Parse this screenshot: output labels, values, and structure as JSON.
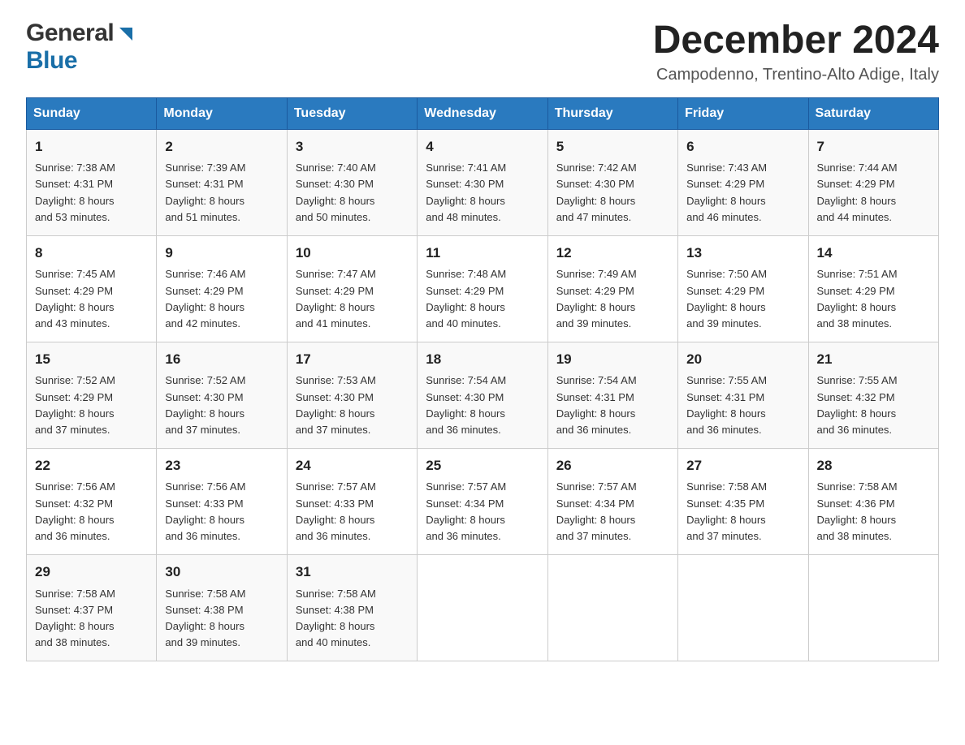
{
  "logo": {
    "general": "General",
    "blue": "Blue"
  },
  "header": {
    "month_year": "December 2024",
    "location": "Campodenno, Trentino-Alto Adige, Italy"
  },
  "weekdays": [
    "Sunday",
    "Monday",
    "Tuesday",
    "Wednesday",
    "Thursday",
    "Friday",
    "Saturday"
  ],
  "weeks": [
    [
      {
        "day": "1",
        "sunrise": "7:38 AM",
        "sunset": "4:31 PM",
        "daylight": "8 hours and 53 minutes."
      },
      {
        "day": "2",
        "sunrise": "7:39 AM",
        "sunset": "4:31 PM",
        "daylight": "8 hours and 51 minutes."
      },
      {
        "day": "3",
        "sunrise": "7:40 AM",
        "sunset": "4:30 PM",
        "daylight": "8 hours and 50 minutes."
      },
      {
        "day": "4",
        "sunrise": "7:41 AM",
        "sunset": "4:30 PM",
        "daylight": "8 hours and 48 minutes."
      },
      {
        "day": "5",
        "sunrise": "7:42 AM",
        "sunset": "4:30 PM",
        "daylight": "8 hours and 47 minutes."
      },
      {
        "day": "6",
        "sunrise": "7:43 AM",
        "sunset": "4:29 PM",
        "daylight": "8 hours and 46 minutes."
      },
      {
        "day": "7",
        "sunrise": "7:44 AM",
        "sunset": "4:29 PM",
        "daylight": "8 hours and 44 minutes."
      }
    ],
    [
      {
        "day": "8",
        "sunrise": "7:45 AM",
        "sunset": "4:29 PM",
        "daylight": "8 hours and 43 minutes."
      },
      {
        "day": "9",
        "sunrise": "7:46 AM",
        "sunset": "4:29 PM",
        "daylight": "8 hours and 42 minutes."
      },
      {
        "day": "10",
        "sunrise": "7:47 AM",
        "sunset": "4:29 PM",
        "daylight": "8 hours and 41 minutes."
      },
      {
        "day": "11",
        "sunrise": "7:48 AM",
        "sunset": "4:29 PM",
        "daylight": "8 hours and 40 minutes."
      },
      {
        "day": "12",
        "sunrise": "7:49 AM",
        "sunset": "4:29 PM",
        "daylight": "8 hours and 39 minutes."
      },
      {
        "day": "13",
        "sunrise": "7:50 AM",
        "sunset": "4:29 PM",
        "daylight": "8 hours and 39 minutes."
      },
      {
        "day": "14",
        "sunrise": "7:51 AM",
        "sunset": "4:29 PM",
        "daylight": "8 hours and 38 minutes."
      }
    ],
    [
      {
        "day": "15",
        "sunrise": "7:52 AM",
        "sunset": "4:29 PM",
        "daylight": "8 hours and 37 minutes."
      },
      {
        "day": "16",
        "sunrise": "7:52 AM",
        "sunset": "4:30 PM",
        "daylight": "8 hours and 37 minutes."
      },
      {
        "day": "17",
        "sunrise": "7:53 AM",
        "sunset": "4:30 PM",
        "daylight": "8 hours and 37 minutes."
      },
      {
        "day": "18",
        "sunrise": "7:54 AM",
        "sunset": "4:30 PM",
        "daylight": "8 hours and 36 minutes."
      },
      {
        "day": "19",
        "sunrise": "7:54 AM",
        "sunset": "4:31 PM",
        "daylight": "8 hours and 36 minutes."
      },
      {
        "day": "20",
        "sunrise": "7:55 AM",
        "sunset": "4:31 PM",
        "daylight": "8 hours and 36 minutes."
      },
      {
        "day": "21",
        "sunrise": "7:55 AM",
        "sunset": "4:32 PM",
        "daylight": "8 hours and 36 minutes."
      }
    ],
    [
      {
        "day": "22",
        "sunrise": "7:56 AM",
        "sunset": "4:32 PM",
        "daylight": "8 hours and 36 minutes."
      },
      {
        "day": "23",
        "sunrise": "7:56 AM",
        "sunset": "4:33 PM",
        "daylight": "8 hours and 36 minutes."
      },
      {
        "day": "24",
        "sunrise": "7:57 AM",
        "sunset": "4:33 PM",
        "daylight": "8 hours and 36 minutes."
      },
      {
        "day": "25",
        "sunrise": "7:57 AM",
        "sunset": "4:34 PM",
        "daylight": "8 hours and 36 minutes."
      },
      {
        "day": "26",
        "sunrise": "7:57 AM",
        "sunset": "4:34 PM",
        "daylight": "8 hours and 37 minutes."
      },
      {
        "day": "27",
        "sunrise": "7:58 AM",
        "sunset": "4:35 PM",
        "daylight": "8 hours and 37 minutes."
      },
      {
        "day": "28",
        "sunrise": "7:58 AM",
        "sunset": "4:36 PM",
        "daylight": "8 hours and 38 minutes."
      }
    ],
    [
      {
        "day": "29",
        "sunrise": "7:58 AM",
        "sunset": "4:37 PM",
        "daylight": "8 hours and 38 minutes."
      },
      {
        "day": "30",
        "sunrise": "7:58 AM",
        "sunset": "4:38 PM",
        "daylight": "8 hours and 39 minutes."
      },
      {
        "day": "31",
        "sunrise": "7:58 AM",
        "sunset": "4:38 PM",
        "daylight": "8 hours and 40 minutes."
      },
      null,
      null,
      null,
      null
    ]
  ],
  "labels": {
    "sunrise": "Sunrise:",
    "sunset": "Sunset:",
    "daylight": "Daylight:"
  }
}
